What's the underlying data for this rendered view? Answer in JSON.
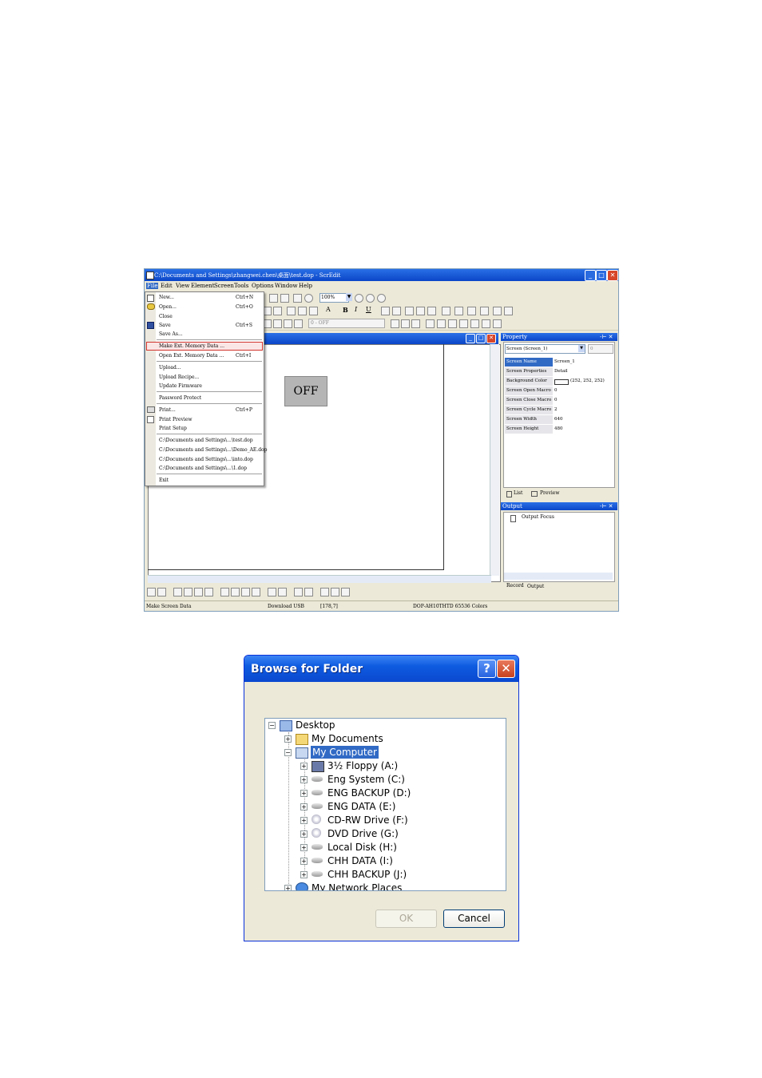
{
  "scredit": {
    "window_title": "C:\\Documents and Settings\\zhangwei.chen\\桌面\\test.dop - ScrEdit",
    "menu": [
      "File",
      "Edit",
      "View",
      "Element",
      "Screen",
      "Tools",
      "Options",
      "Window",
      "Help"
    ],
    "zoom": "100%",
    "state_select": "0 - OFF",
    "file_menu": {
      "items": [
        {
          "label": "New...",
          "shortcut": "Ctrl+N"
        },
        {
          "label": "Open...",
          "shortcut": "Ctrl+O"
        },
        {
          "label": "Close",
          "shortcut": ""
        },
        {
          "label": "Save",
          "shortcut": "Ctrl+S"
        },
        {
          "label": "Save As...",
          "shortcut": ""
        },
        {
          "label": "Make Ext. Memory Data ...",
          "shortcut": ""
        },
        {
          "label": "Open Ext. Memory Data ...",
          "shortcut": "Ctrl+I"
        },
        {
          "label": "Upload...",
          "shortcut": ""
        },
        {
          "label": "Upload Recipe...",
          "shortcut": ""
        },
        {
          "label": "Update Firmware",
          "shortcut": ""
        },
        {
          "label": "Password Protect",
          "shortcut": ""
        },
        {
          "label": "Print...",
          "shortcut": "Ctrl+P"
        },
        {
          "label": "Print Preview",
          "shortcut": ""
        },
        {
          "label": "Print Setup",
          "shortcut": ""
        },
        {
          "label": "C:\\Documents and Settings\\...\\test.dop",
          "shortcut": ""
        },
        {
          "label": "C:\\Documents and Settings\\...\\Demo_AE.dop",
          "shortcut": ""
        },
        {
          "label": "C:\\Documents and Settings\\...\\into.dop",
          "shortcut": ""
        },
        {
          "label": "C:\\Documents and Settings\\...\\1.dop",
          "shortcut": ""
        },
        {
          "label": "Exit",
          "shortcut": ""
        }
      ]
    },
    "canvas_button": "OFF",
    "property": {
      "title": "Property",
      "screen_select": "Screen (Screen_1)",
      "screen_num": "0",
      "rows": [
        {
          "key": "Screen Name",
          "value": "Screen_1"
        },
        {
          "key": "Screen Properties",
          "value": "Detail"
        },
        {
          "key": "Background Color",
          "value": "(252, 252, 252)"
        },
        {
          "key": "Screen Open Macro",
          "value": "0"
        },
        {
          "key": "Screen Close Macro",
          "value": "0"
        },
        {
          "key": "Screen Cycle Macro",
          "value": "2"
        },
        {
          "key": "Screen Width",
          "value": "640"
        },
        {
          "key": "Screen Height",
          "value": "480"
        }
      ],
      "tabs": [
        "List",
        "Preview"
      ]
    },
    "output": {
      "title": "Output",
      "item": "Output Focus",
      "tabs": [
        "Record",
        "Output"
      ]
    },
    "status": {
      "left": "Make Screen Data",
      "download": "Download USB",
      "coords": "[178,7]",
      "model": "DOP-AH10THTD 65536 Colors"
    }
  },
  "browse_dialog": {
    "title": "Browse for Folder",
    "tree": [
      {
        "label": "Desktop",
        "level": 0,
        "icon": "desktop-icon"
      },
      {
        "label": "My Documents",
        "level": 1,
        "icon": "folder-icon"
      },
      {
        "label": "My Computer",
        "level": 1,
        "icon": "computer-icon",
        "selected": true
      },
      {
        "label": "3½ Floppy (A:)",
        "level": 2,
        "icon": "floppy-icon"
      },
      {
        "label": "Eng System (C:)",
        "level": 2,
        "icon": "drive-icon"
      },
      {
        "label": "ENG BACKUP (D:)",
        "level": 2,
        "icon": "drive-icon"
      },
      {
        "label": "ENG DATA (E:)",
        "level": 2,
        "icon": "drive-icon"
      },
      {
        "label": "CD-RW Drive (F:)",
        "level": 2,
        "icon": "cd-drive-icon"
      },
      {
        "label": "DVD Drive (G:)",
        "level": 2,
        "icon": "cd-drive-icon"
      },
      {
        "label": "Local Disk (H:)",
        "level": 2,
        "icon": "drive-icon"
      },
      {
        "label": "CHH DATA (I:)",
        "level": 2,
        "icon": "drive-icon"
      },
      {
        "label": "CHH BACKUP (J:)",
        "level": 2,
        "icon": "drive-icon"
      },
      {
        "label": "My Network Places",
        "level": 1,
        "icon": "network-icon"
      }
    ],
    "ok": "OK",
    "cancel": "Cancel"
  }
}
